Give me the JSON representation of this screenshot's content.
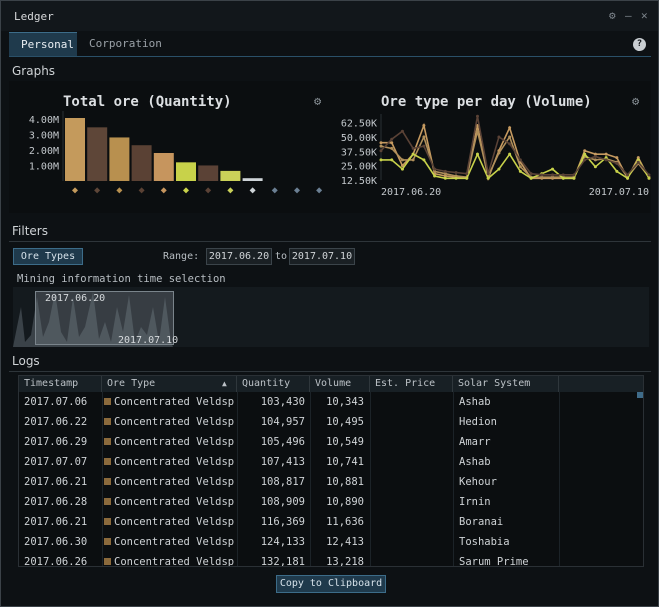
{
  "window": {
    "title": "Ledger",
    "controls": [
      "⚙",
      "–",
      "✕"
    ]
  },
  "tabs": [
    {
      "label": "Personal",
      "active": true
    },
    {
      "label": "Corporation",
      "active": false
    }
  ],
  "help_label": "?",
  "sections": {
    "graphs": "Graphs",
    "filters": "Filters",
    "logs": "Logs"
  },
  "chart_data": [
    {
      "type": "bar",
      "title": "Total ore (Quantity)",
      "yticks": [
        "4.00M",
        "3.00M",
        "2.00M",
        "1.00M"
      ],
      "ylim": [
        0,
        4500000
      ],
      "values": [
        4050000,
        3450000,
        2800000,
        2300000,
        1800000,
        1200000,
        1000000,
        650000,
        180000,
        0,
        0,
        0
      ],
      "colors": [
        "#c49a5c",
        "#5e4638",
        "#b8904f",
        "#5a4134",
        "#c6955e",
        "#c8d24a",
        "#5b4236",
        "#cad159",
        "#ced4d8",
        "#6b7f93",
        "#6b7f93",
        "#6b7f93"
      ],
      "category_icons": [
        "ore-icon-1",
        "ore-icon-2",
        "ore-icon-3",
        "ore-icon-4",
        "ore-icon-5",
        "ore-icon-6",
        "ore-icon-7",
        "ore-icon-8",
        "ore-icon-9",
        "ore-icon-10",
        "ore-icon-11",
        "ore-icon-12"
      ]
    },
    {
      "type": "line",
      "title": "Ore type per day (Volume)",
      "yticks": [
        "62.50K",
        "50.00K",
        "37.50K",
        "25.00K",
        "12.50K"
      ],
      "xtick_labels": [
        "2017.06.20",
        "2017.07.10"
      ],
      "ylim": [
        12500,
        70000
      ],
      "series": [
        {
          "color": "#c69a60",
          "values": [
            45000,
            45000,
            25000,
            35000,
            60000,
            18000,
            16000,
            15000,
            14000,
            60000,
            14000,
            38000,
            58000,
            28000,
            14000,
            14000,
            14000,
            14000,
            14000,
            38000,
            35000,
            35000,
            32000,
            14000,
            32000,
            14000
          ]
        },
        {
          "color": "#b08f5a",
          "values": [
            42000,
            40000,
            30000,
            30000,
            50000,
            20000,
            18000,
            16000,
            15000,
            55000,
            16000,
            36000,
            50000,
            24000,
            15000,
            15000,
            15000,
            15000,
            15000,
            33000,
            30000,
            31000,
            28000,
            15000,
            27000,
            15000
          ]
        },
        {
          "color": "#c8d24a",
          "values": [
            30000,
            30000,
            22000,
            35000,
            30000,
            16000,
            14000,
            14000,
            14000,
            35000,
            14000,
            22000,
            35000,
            20000,
            14000,
            18000,
            22000,
            14000,
            14000,
            35000,
            24000,
            32000,
            20000,
            14000,
            30000,
            14000
          ]
        },
        {
          "color": "#5a4236",
          "values": [
            38000,
            48000,
            55000,
            40000,
            42000,
            22000,
            20000,
            19000,
            18000,
            68000,
            18000,
            50000,
            44000,
            30000,
            18000,
            17000,
            17000,
            17000,
            17000,
            30000,
            33000,
            30000,
            27000,
            17000,
            28000,
            17000
          ]
        }
      ]
    }
  ],
  "filters": {
    "ore_types_label": "Ore Types",
    "range_label": "Range:",
    "from_date": "2017.06.20",
    "to_label": "to",
    "to_date": "2017.07.10",
    "time_selection_label": "Mining information time selection",
    "selection_start": "2017.06.20",
    "selection_end": "2017.07.10"
  },
  "logs": {
    "columns": [
      "Timestamp",
      "Ore Type",
      "Quantity",
      "Volume",
      "Est. Price",
      "Solar System"
    ],
    "sort_indicator": "▲",
    "rows": [
      {
        "timestamp": "2017.07.06",
        "ore_type": "Concentrated Veldspar",
        "quantity": "103,430",
        "volume": "10,343",
        "est_price": "",
        "solar_system": "Ashab"
      },
      {
        "timestamp": "2017.06.22",
        "ore_type": "Concentrated Veldspar",
        "quantity": "104,957",
        "volume": "10,495",
        "est_price": "",
        "solar_system": "Hedion"
      },
      {
        "timestamp": "2017.06.29",
        "ore_type": "Concentrated Veldspar",
        "quantity": "105,496",
        "volume": "10,549",
        "est_price": "",
        "solar_system": "Amarr"
      },
      {
        "timestamp": "2017.07.07",
        "ore_type": "Concentrated Veldspar",
        "quantity": "107,413",
        "volume": "10,741",
        "est_price": "",
        "solar_system": "Ashab"
      },
      {
        "timestamp": "2017.06.21",
        "ore_type": "Concentrated Veldspar",
        "quantity": "108,817",
        "volume": "10,881",
        "est_price": "",
        "solar_system": "Kehour"
      },
      {
        "timestamp": "2017.06.28",
        "ore_type": "Concentrated Veldspar",
        "quantity": "108,909",
        "volume": "10,890",
        "est_price": "",
        "solar_system": "Irnin"
      },
      {
        "timestamp": "2017.06.21",
        "ore_type": "Concentrated Veldspar",
        "quantity": "116,369",
        "volume": "11,636",
        "est_price": "",
        "solar_system": "Boranai"
      },
      {
        "timestamp": "2017.06.30",
        "ore_type": "Concentrated Veldspar",
        "quantity": "124,133",
        "volume": "12,413",
        "est_price": "",
        "solar_system": "Toshabia"
      },
      {
        "timestamp": "2017.06.26",
        "ore_type": "Concentrated Veldspar",
        "quantity": "132,181",
        "volume": "13,218",
        "est_price": "",
        "solar_system": "Sarum Prime"
      }
    ]
  },
  "copy_label": "Copy to Clipboard"
}
